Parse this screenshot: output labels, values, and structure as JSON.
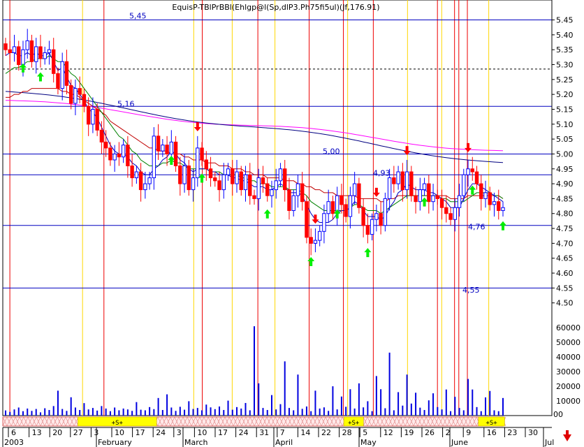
{
  "window_title": "EquisP-TBlPrBBl(Ehlgp@l(Sp,dlP3.Ph75fi5ul)(Jf,176.91)",
  "chart_data": {
    "type": "candlestick",
    "y_axis": {
      "min": 4.45,
      "max": 5.47,
      "ticks": [
        "5.45",
        "5.40",
        "5.35",
        "5.30",
        "5.25",
        "5.20",
        "5.15",
        "5.10",
        "5.05",
        "5.00",
        "4.95",
        "4.90",
        "4.85",
        "4.80",
        "4.75",
        "4.70",
        "4.65",
        "4.60",
        "4.55",
        "4.50"
      ]
    },
    "volume_axis": {
      "max": 62000,
      "ticks": [
        "60000",
        "50000",
        "40000",
        "30000",
        "20000",
        "10000",
        "00"
      ]
    },
    "x_day_labels": [
      "6",
      "13",
      "20",
      "27",
      "3",
      "10",
      "17",
      "24",
      "3",
      "10",
      "17",
      "24",
      "31",
      "7",
      "14",
      "22",
      "28",
      "5",
      "12",
      "19",
      "26",
      "2",
      "9",
      "16",
      "23",
      "30"
    ],
    "x_month_labels": [
      "2003",
      "February",
      "March",
      "April",
      "May",
      "June",
      "Jul"
    ],
    "level_labels": [
      "5,45",
      "5,16",
      "5,00",
      "4,93",
      "4,76",
      "4,55"
    ],
    "horizontal_levels": [
      5.45,
      5.16,
      5.0,
      4.93,
      4.76,
      4.55
    ],
    "dotted_level": 5.285,
    "signal_band_labels": [
      "+S+",
      "+S+",
      "+S+"
    ],
    "colors": {
      "up": "#0000ff",
      "down": "#ff0000",
      "ma_short": "#0000c0",
      "ma_mid": "#008000",
      "ma_long": "#c00000",
      "ma_longer": "#000080",
      "ma_longest": "#ff00ff",
      "buy_arrow": "#00ee00",
      "sell_arrow": "#ff0000",
      "yellow_line": "#ffd700",
      "red_line": "#ee0000"
    },
    "closes": [
      5.35,
      5.34,
      5.36,
      5.3,
      5.35,
      5.38,
      5.31,
      5.36,
      5.32,
      5.34,
      5.35,
      5.27,
      5.22,
      5.31,
      5.23,
      5.17,
      5.22,
      5.2,
      5.16,
      5.1,
      5.15,
      5.08,
      5.04,
      5.02,
      4.98,
      5.0,
      4.99,
      5.03,
      4.96,
      4.92,
      4.94,
      4.88,
      4.9,
      4.92,
      5.06,
      5.01,
      5.03,
      5.0,
      5.04,
      4.96,
      4.9,
      4.96,
      4.88,
      4.92,
      5.02,
      4.98,
      4.95,
      4.92,
      4.91,
      4.88,
      4.93,
      4.95,
      4.9,
      4.94,
      4.88,
      4.93,
      4.86,
      4.85,
      4.92,
      4.9,
      4.86,
      4.88,
      4.91,
      4.95,
      4.88,
      4.81,
      4.86,
      4.9,
      4.84,
      4.72,
      4.7,
      4.71,
      4.74,
      4.8,
      4.84,
      4.8,
      4.86,
      4.83,
      4.79,
      4.86,
      4.9,
      4.82,
      4.76,
      4.73,
      4.78,
      4.8,
      4.76,
      4.85,
      4.92,
      4.9,
      4.94,
      4.88,
      4.94,
      4.86,
      4.84,
      4.88,
      4.9,
      4.84,
      4.86,
      4.85,
      4.82,
      4.8,
      4.78,
      4.82,
      4.86,
      4.93,
      4.95,
      4.94,
      4.9,
      4.85,
      4.87,
      4.83,
      4.84,
      4.81,
      4.82
    ],
    "volumes": [
      3500,
      2500,
      4200,
      5500,
      3000,
      4800,
      3200,
      4500,
      2200,
      5000,
      3800,
      6500,
      17000,
      4500,
      3200,
      12500,
      5500,
      3800,
      8500,
      4200,
      5200,
      3400,
      6500,
      4800,
      3000,
      5500,
      3600,
      4800,
      4200,
      3200,
      9200,
      4000,
      3600,
      5800,
      4400,
      12000,
      3800,
      14500,
      5500,
      3200,
      6000,
      4000,
      9800,
      4500,
      5200,
      3600,
      7500,
      5600,
      4400,
      6200,
      3800,
      10200,
      4000,
      5800,
      4800,
      8600,
      3600,
      61000,
      22000,
      5200,
      3800,
      14000,
      4200,
      7800,
      37000,
      5200,
      3600,
      28000,
      4600,
      6200,
      3000,
      17000,
      4800,
      5600,
      3200,
      20000,
      4200,
      13000,
      6000,
      18000,
      4800,
      22000,
      5600,
      9800,
      3000,
      27000,
      18000,
      5000,
      43000,
      3600,
      16000,
      6800,
      28000,
      8200,
      15600,
      5400,
      3800,
      10400,
      15200,
      5800,
      4200,
      17800,
      3000,
      12800,
      5200,
      3600,
      25000,
      17800,
      5800,
      3000,
      12400,
      16800,
      3600,
      3000,
      12000
    ],
    "ma_short": [
      5.33,
      5.34,
      5.34,
      5.33,
      5.33,
      5.34,
      5.33,
      5.34,
      5.33,
      5.33,
      5.34,
      5.31,
      5.28,
      5.29,
      5.26,
      5.23,
      5.22,
      5.2,
      5.18,
      5.15,
      5.14,
      5.12,
      5.09,
      5.06,
      5.03,
      5.01,
      5.0,
      5.0,
      4.99,
      4.97,
      4.96,
      4.94,
      4.93,
      4.93,
      4.95,
      4.96,
      4.98,
      4.99,
      5.01,
      5.0,
      4.98,
      4.97,
      4.95,
      4.94,
      4.95,
      4.95,
      4.95,
      4.94,
      4.94,
      4.93,
      4.93,
      4.93,
      4.92,
      4.92,
      4.91,
      4.91,
      4.9,
      4.89,
      4.89,
      4.89,
      4.88,
      4.88,
      4.89,
      4.9,
      4.89,
      4.87,
      4.87,
      4.87,
      4.86,
      4.83,
      4.8,
      4.78,
      4.77,
      4.77,
      4.77,
      4.78,
      4.8,
      4.81,
      4.81,
      4.82,
      4.84,
      4.83,
      4.81,
      4.79,
      4.79,
      4.79,
      4.78,
      4.79,
      4.82,
      4.84,
      4.87,
      4.88,
      4.9,
      4.89,
      4.88,
      4.88,
      4.88,
      4.87,
      4.87,
      4.86,
      4.85,
      4.84,
      4.82,
      4.82,
      4.82,
      4.85,
      4.88,
      4.9,
      4.9,
      4.89,
      4.88,
      4.87,
      4.86,
      4.85,
      4.84
    ],
    "ma_mid": [
      5.27,
      5.28,
      5.29,
      5.29,
      5.3,
      5.31,
      5.31,
      5.32,
      5.32,
      5.32,
      5.33,
      5.32,
      5.31,
      5.31,
      5.29,
      5.27,
      5.26,
      5.24,
      5.22,
      5.2,
      5.18,
      5.16,
      5.14,
      5.12,
      5.1,
      5.08,
      5.06,
      5.05,
      5.03,
      5.01,
      5.0,
      4.98,
      4.97,
      4.96,
      4.96,
      4.96,
      4.97,
      4.97,
      4.98,
      4.97,
      4.97,
      4.96,
      4.95,
      4.95,
      4.95,
      4.95,
      4.95,
      4.94,
      4.94,
      4.94,
      4.93,
      4.93,
      4.93,
      4.93,
      4.92,
      4.92,
      4.91,
      4.91,
      4.9,
      4.9,
      4.9,
      4.89,
      4.89,
      4.89,
      4.89,
      4.88,
      4.88,
      4.88,
      4.87,
      4.86,
      4.84,
      4.83,
      4.82,
      4.81,
      4.81,
      4.81,
      4.81,
      4.81,
      4.81,
      4.82,
      4.83,
      4.83,
      4.82,
      4.81,
      4.81,
      4.81,
      4.8,
      4.81,
      4.82,
      4.83,
      4.84,
      4.85,
      4.86,
      4.86,
      4.86,
      4.86,
      4.86,
      4.86,
      4.86,
      4.86,
      4.85,
      4.85,
      4.84,
      4.84,
      4.84,
      4.84,
      4.85,
      4.86,
      4.87,
      4.87,
      4.87,
      4.87,
      4.86,
      4.86,
      4.85
    ],
    "ma_long": [
      5.19,
      5.19,
      5.2,
      5.2,
      5.21,
      5.21,
      5.22,
      5.22,
      5.22,
      5.22,
      5.22,
      5.22,
      5.22,
      5.21,
      5.21,
      5.2,
      5.2,
      5.19,
      5.18,
      5.17,
      5.16,
      5.15,
      5.14,
      5.13,
      5.11,
      5.1,
      5.09,
      5.08,
      5.07,
      5.06,
      5.05,
      5.04,
      5.03,
      5.02,
      5.02,
      5.01,
      5.01,
      5.01,
      5.0,
      5.0,
      5.0,
      4.99,
      4.99,
      4.98,
      4.98,
      4.98,
      4.97,
      4.97,
      4.97,
      4.96,
      4.96,
      4.96,
      4.95,
      4.95,
      4.95,
      4.94,
      4.94,
      4.93,
      4.93,
      4.93,
      4.92,
      4.92,
      4.92,
      4.92,
      4.91,
      4.91,
      4.91,
      4.9,
      4.9,
      4.89,
      4.89,
      4.88,
      4.88,
      4.87,
      4.87,
      4.87,
      4.86,
      4.86,
      4.86,
      4.86,
      4.86,
      4.85,
      4.85,
      4.85,
      4.85,
      4.85,
      4.84,
      4.84,
      4.85,
      4.85,
      4.86,
      4.86,
      4.86,
      4.86,
      4.86,
      4.86,
      4.86,
      4.86,
      4.86,
      4.86,
      4.86,
      4.86,
      4.85,
      4.85,
      4.85,
      4.85,
      4.86,
      4.86,
      4.86,
      4.86,
      4.86,
      4.86,
      4.86,
      4.86,
      4.85
    ],
    "ma_longer_start": 5.21,
    "ma_longer_end": 4.97,
    "ma_longest_start": 5.18,
    "ma_longest_end": 5.01,
    "yellow_line_bars": [
      18,
      44,
      53,
      63,
      80,
      94,
      102,
      113
    ],
    "red_line_bars": [
      1,
      23,
      46,
      59,
      71,
      79,
      86,
      101,
      105,
      106,
      108
    ],
    "buy_arrow_bars": [
      4,
      8,
      38,
      45,
      60,
      70,
      76,
      83,
      96,
      107,
      115
    ],
    "sell_arrow_bars": [
      52,
      83,
      100,
      108,
      125
    ],
    "signal_bands": [
      [
        22,
        46
      ],
      [
        103,
        109
      ],
      [
        144,
        152
      ]
    ]
  }
}
